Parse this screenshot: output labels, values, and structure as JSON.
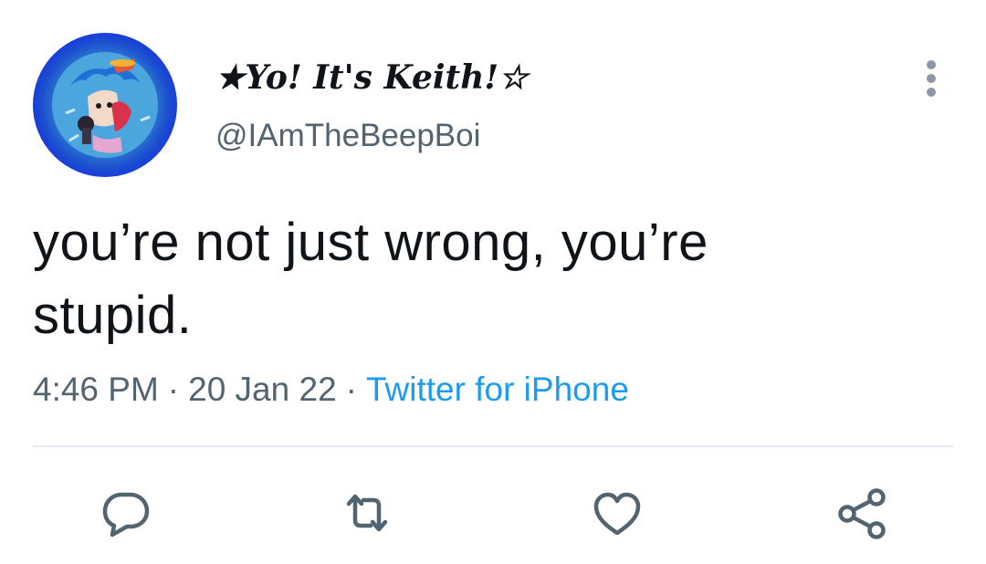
{
  "author": {
    "display_name": "★Yo! It's Keith!☆",
    "handle": "@IAmTheBeepBoi"
  },
  "tweet": {
    "text_line1": "you’re not just wrong, you’re",
    "text_line2": "stupid.",
    "time": "4:46 PM",
    "date": "20 Jan 22",
    "separator": "·",
    "source": "Twitter for iPhone"
  },
  "actions": {
    "icons": [
      "reply-icon",
      "retweet-icon",
      "like-icon",
      "share-icon"
    ]
  },
  "colors": {
    "text": "#0f1419",
    "secondary": "#536471",
    "accent": "#1d9bf0",
    "avatar_ring": "#1337e0"
  }
}
